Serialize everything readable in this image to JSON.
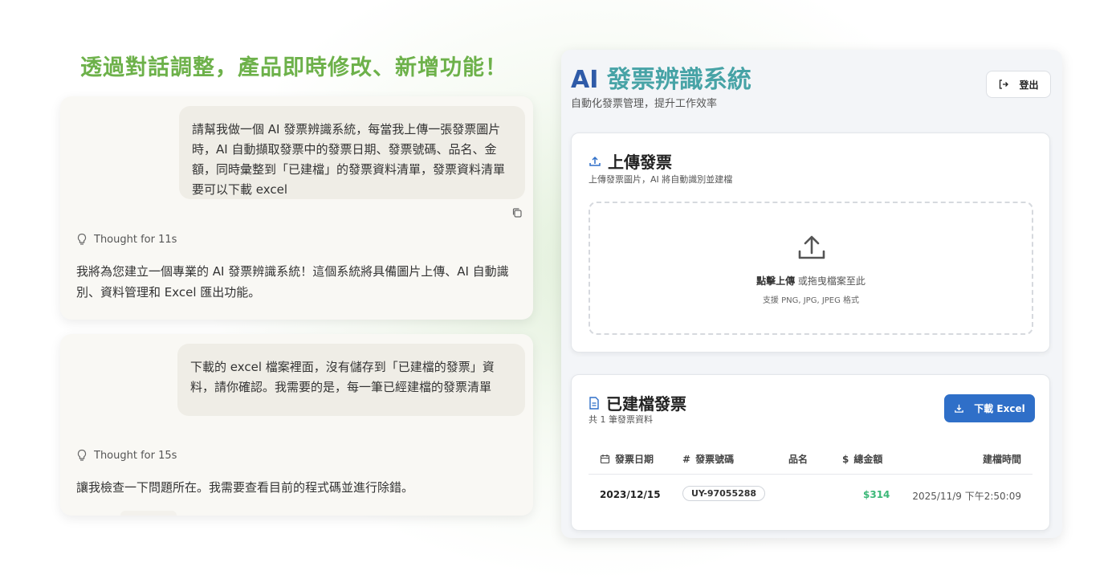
{
  "headline": "透過對話調整，產品即時修改、新增功能！",
  "chat": {
    "card1": {
      "user_message": "請幫我做一個 AI 發票辨識系統，每當我上傳一張發票圖片時，AI 自動擷取發票中的發票日期、發票號碼、品名、金額，同時彙整到「已建檔」的發票資料清單，發票資料清單要可以下載 excel",
      "thought": "Thought for 11s",
      "assistant_message": "我將為您建立一個專業的 AI 發票辨識系統！這個系統將具備圖片上傳、AI 自動識別、資料管理和 Excel 匯出功能。"
    },
    "card2": {
      "user_message": "下載的 excel 檔案裡面，沒有儲存到「已建檔的發票」資料，請你確認。我需要的是，每一筆已經建檔的發票清單",
      "thought": "Thought for 15s",
      "assistant_message": "讓我檢查一下問題所在。我需要查看目前的程式碼並進行除錯。"
    }
  },
  "app": {
    "title_prefix": "AI",
    "title_main": "發票辨識系統",
    "subtitle": "自動化發票管理，提升工作效率",
    "logout_label": "登出",
    "upload": {
      "title": "上傳發票",
      "subtitle": "上傳發票圖片，AI 將自動識別並建檔",
      "click_label": "點擊上傳",
      "drag_label": "或拖曳檔案至此",
      "formats": "支援 PNG, JPG, JPEG 格式"
    },
    "invoices": {
      "title": "已建檔發票",
      "count_text": "共 1 筆發票資料",
      "download_label": "下載 Excel",
      "columns": [
        "發票日期",
        "發票號碼",
        "品名",
        "總金額",
        "建檔時間"
      ],
      "rows": [
        {
          "date": "2023/12/15",
          "number": "UY-97055288",
          "item": "",
          "amount": "$314",
          "created": "2025/11/9 下午2:50:09"
        }
      ]
    }
  },
  "colors": {
    "headline_green": "#6db14a",
    "primary_blue": "#2f6fc8",
    "amount_green": "#3cb878"
  }
}
